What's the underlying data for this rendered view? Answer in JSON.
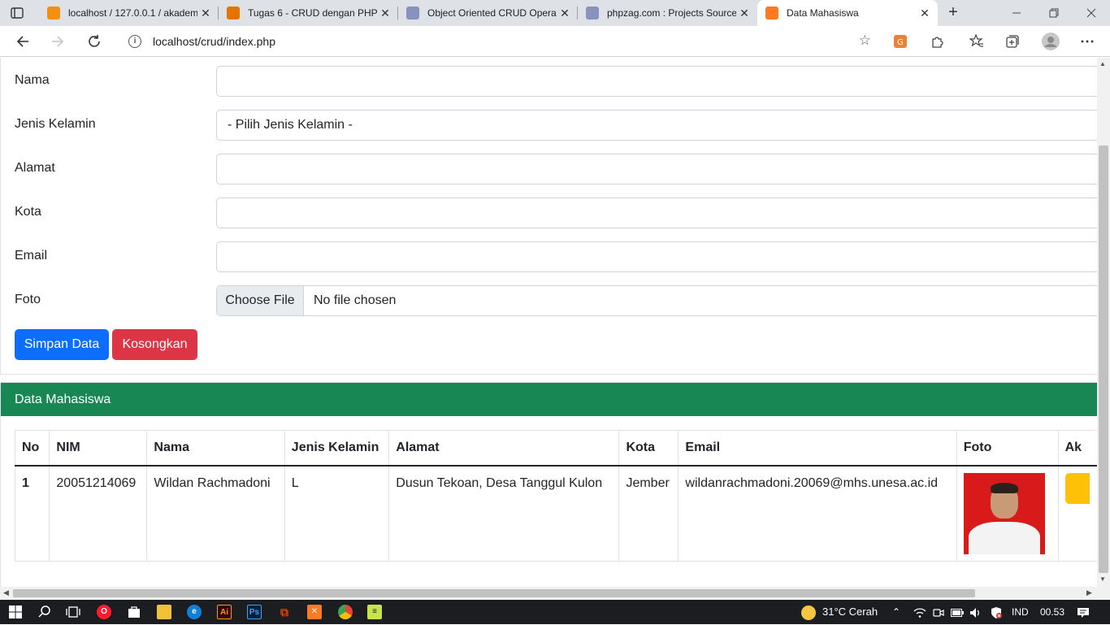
{
  "browser": {
    "tabs": [
      {
        "title": "localhost / 127.0.0.1 / akadem",
        "favicon_color": "#f29111",
        "favicon_icon": "phpmyadmin-icon"
      },
      {
        "title": "Tugas 6 - CRUD dengan PHP",
        "favicon_color": "#e37400",
        "favicon_icon": "classroom-icon"
      },
      {
        "title": "Object Oriented CRUD Opera",
        "favicon_color": "#8892bf",
        "favicon_icon": "php-icon"
      },
      {
        "title": "phpzag.com : Projects Source",
        "favicon_color": "#8892bf",
        "favicon_icon": "php-icon"
      },
      {
        "title": "Data Mahasiswa",
        "favicon_color": "#fb7a24",
        "favicon_icon": "xampp-icon"
      }
    ],
    "url": "localhost/crud/index.php"
  },
  "form": {
    "fields": [
      {
        "label": "Nama",
        "value": ""
      },
      {
        "label": "Jenis Kelamin",
        "value": "- Pilih Jenis Kelamin -"
      },
      {
        "label": "Alamat",
        "value": ""
      },
      {
        "label": "Kota",
        "value": ""
      },
      {
        "label": "Email",
        "value": ""
      }
    ],
    "foto": {
      "label": "Foto",
      "button": "Choose File",
      "status": "No file chosen"
    },
    "save_label": "Simpan Data",
    "clear_label": "Kosongkan"
  },
  "table_card": {
    "header": "Data Mahasiswa",
    "columns": [
      "No",
      "NIM",
      "Nama",
      "Jenis Kelamin",
      "Alamat",
      "Kota",
      "Email",
      "Foto",
      "Ak"
    ],
    "rows": [
      {
        "no": "1",
        "nim": "20051214069",
        "nama": "Wildan Rachmadoni",
        "jk": "L",
        "alamat": "Dusun Tekoan, Desa Tanggul Kulon",
        "kota": "Jember",
        "email": "wildanrachmadoni.20069@mhs.unesa.ac.id"
      }
    ]
  },
  "taskbar": {
    "weather": "31°C  Cerah",
    "language": "IND",
    "time": "00.53"
  },
  "colors": {
    "primary": "#0d6efd",
    "danger": "#dc3545",
    "success": "#198754",
    "warning": "#ffc107"
  }
}
